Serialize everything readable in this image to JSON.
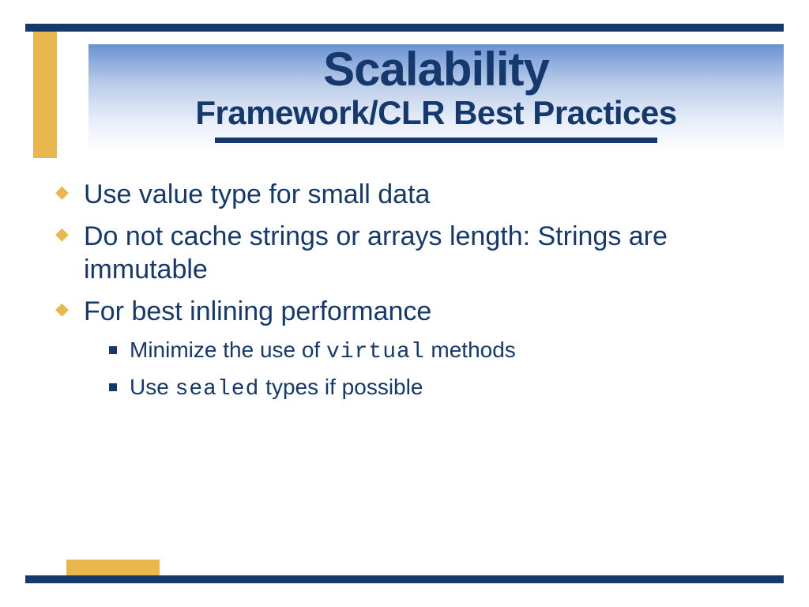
{
  "colors": {
    "navy": "#15396d",
    "gold": "#e8b74d",
    "grad_top": "#6a91d1"
  },
  "header": {
    "title": "Scalability",
    "subtitle": "Framework/CLR Best Practices"
  },
  "bullets": [
    {
      "text": "Use value type for small data"
    },
    {
      "text": "Do not cache strings or arrays length: Strings are immutable"
    },
    {
      "text": "For best inlining performance",
      "sub": [
        {
          "pre": "Minimize the use of ",
          "mono": "virtual",
          "post": " methods"
        },
        {
          "pre": "Use ",
          "mono": "sealed",
          "post": " types if possible"
        }
      ]
    }
  ]
}
